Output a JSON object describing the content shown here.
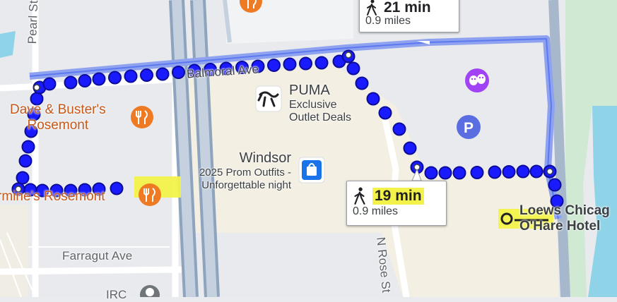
{
  "map": {
    "streets": {
      "pearl": "Pearl St",
      "balmoral": "Balmoral Ave",
      "farragut": "Farragut Ave",
      "n_rose": "N Rose St"
    },
    "places": {
      "dave_busters_line1": "Dave & Buster's",
      "dave_busters_line2": "Rosemont",
      "carmines": "rmine's Rosemont",
      "puma_name": "PUMA",
      "puma_sub1": "Exclusive",
      "puma_sub2": "Outlet Deals",
      "windsor_name": "Windsor",
      "windsor_sub1": "2025 Prom Outfits -",
      "windsor_sub2": "Unforgettable night",
      "loews_line1": "Loews Chicag",
      "loews_line2": "O'Hare Hotel",
      "bottom_partial": "IRC"
    },
    "icons": {
      "restaurant": "fork-knife-icon",
      "puma": "puma-logo-icon",
      "shopping": "shopping-bag-icon",
      "parking": "parking-icon",
      "entertainment": "theater-masks-icon",
      "walk": "walking-person-icon"
    },
    "colors": {
      "route_main": "#1a1aff",
      "route_alt": "#8ea2f0",
      "highway": "#8da3be",
      "restaurant": "#ee7b23",
      "shopping": "#1a73e8",
      "parking": "#5b6ee1",
      "entertainment": "#a142f4",
      "highlight": "#f2f24a"
    }
  },
  "route_cards": [
    {
      "mode": "walk",
      "duration": "21 min",
      "distance": "0.9 miles"
    },
    {
      "mode": "walk",
      "duration": "19 min",
      "distance": "0.9 miles"
    }
  ]
}
